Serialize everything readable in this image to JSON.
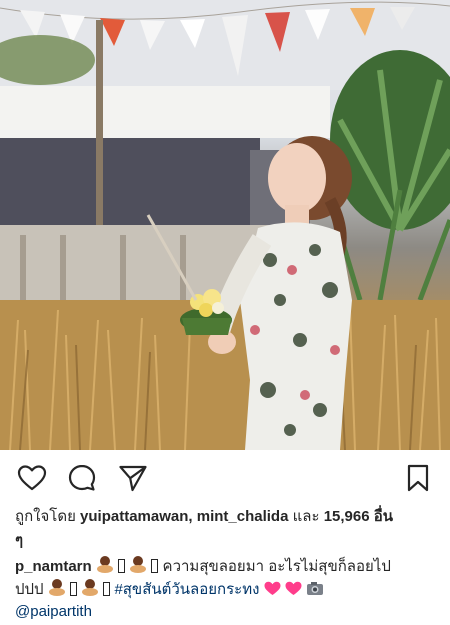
{
  "post": {
    "likes": {
      "prefix": "ถูกใจโดย",
      "users": "yuipattamawan, mint_chalida",
      "conjunction": "และ",
      "count": "15,966",
      "suffix": "อื่น",
      "wrap": "ๆ"
    },
    "caption": {
      "username": "p_namtarn",
      "text_1": "ความสุขลอยมา อะไรไม่สุขก็ลอยไป",
      "text_2": "ปปป",
      "hashtag": "#สุขสันต์วันลอยกระทง",
      "mention": "@paipartith"
    },
    "icons": {
      "like": "heart-icon",
      "comment": "comment-bubble-icon",
      "share": "paper-plane-icon",
      "save": "bookmark-icon"
    },
    "colors": {
      "text": "#262626",
      "link": "#003569",
      "heart_emoji": "#ff3d8b"
    }
  }
}
